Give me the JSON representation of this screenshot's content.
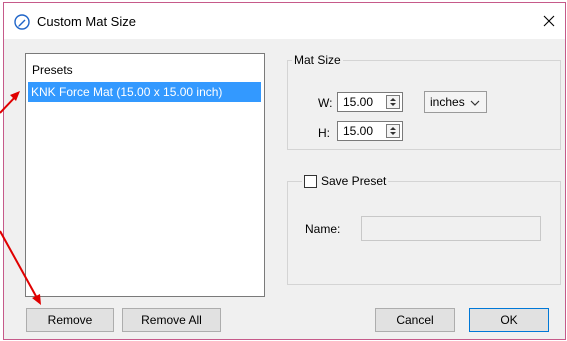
{
  "window": {
    "title": "Custom Mat Size",
    "icon": "pencil-circle-icon",
    "close_icon": "close-icon"
  },
  "presets": {
    "label": "Presets",
    "items": [
      "KNK Force Mat (15.00 x 15.00 inch)"
    ],
    "selected_index": 0
  },
  "mat_size": {
    "legend": "Mat Size",
    "width_label": "W:",
    "width_value": "15.00",
    "height_label": "H:",
    "height_value": "15.00",
    "unit": "inches"
  },
  "save_preset": {
    "label": "Save Preset",
    "checked": false,
    "name_label": "Name:",
    "name_value": ""
  },
  "buttons": {
    "remove": "Remove",
    "remove_all": "Remove All",
    "cancel": "Cancel",
    "ok": "OK"
  },
  "colors": {
    "selection": "#3399ff",
    "annotation_arrow": "#e00000",
    "window_border": "#c65a8a"
  }
}
